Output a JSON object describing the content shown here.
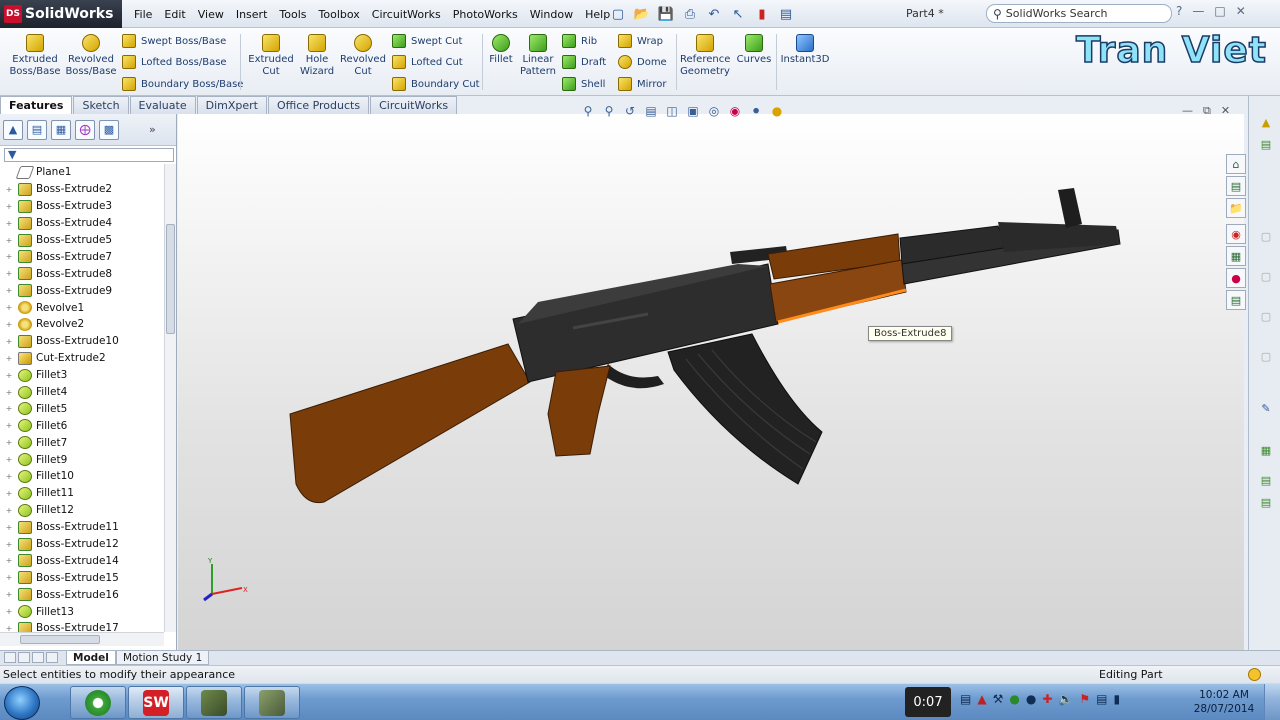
{
  "app": {
    "name": "SolidWorks",
    "doc_title": "Part4 *",
    "brand_text": "Tran Viet"
  },
  "menu": [
    "File",
    "Edit",
    "View",
    "Insert",
    "Tools",
    "Toolbox",
    "CircuitWorks",
    "PhotoWorks",
    "Window",
    "Help"
  ],
  "search": {
    "placeholder": "SolidWorks Search"
  },
  "commands": {
    "extruded_boss": "Extruded Boss/Base",
    "revolved_boss": "Revolved Boss/Base",
    "swept_boss": "Swept Boss/Base",
    "lofted_boss": "Lofted Boss/Base",
    "boundary_boss": "Boundary Boss/Base",
    "extruded_cut": "Extruded Cut",
    "hole_wizard": "Hole Wizard",
    "revolved_cut": "Revolved Cut",
    "swept_cut": "Swept Cut",
    "lofted_cut": "Lofted Cut",
    "boundary_cut": "Boundary Cut",
    "fillet": "Fillet",
    "linear_pattern": "Linear Pattern",
    "rib": "Rib",
    "draft": "Draft",
    "shell": "Shell",
    "wrap": "Wrap",
    "dome": "Dome",
    "mirror": "Mirror",
    "reference_geometry": "Reference Geometry",
    "curves": "Curves",
    "instant3d": "Instant3D"
  },
  "tabs": [
    "Features",
    "Sketch",
    "Evaluate",
    "DimXpert",
    "Office Products",
    "CircuitWorks"
  ],
  "tree": [
    {
      "label": "Plane1",
      "icon": "plane-icon"
    },
    {
      "label": "Boss-Extrude2",
      "icon": "extrude-icon"
    },
    {
      "label": "Boss-Extrude3",
      "icon": "extrude-icon"
    },
    {
      "label": "Boss-Extrude4",
      "icon": "extrude-icon"
    },
    {
      "label": "Boss-Extrude5",
      "icon": "extrude-icon"
    },
    {
      "label": "Boss-Extrude7",
      "icon": "extrude-icon"
    },
    {
      "label": "Boss-Extrude8",
      "icon": "extrude-icon"
    },
    {
      "label": "Boss-Extrude9",
      "icon": "extrude-icon"
    },
    {
      "label": "Revolve1",
      "icon": "revolve-icon"
    },
    {
      "label": "Revolve2",
      "icon": "revolve-icon"
    },
    {
      "label": "Boss-Extrude10",
      "icon": "extrude-icon"
    },
    {
      "label": "Cut-Extrude2",
      "icon": "cut-icon"
    },
    {
      "label": "Fillet3",
      "icon": "fillet-icon"
    },
    {
      "label": "Fillet4",
      "icon": "fillet-icon"
    },
    {
      "label": "Fillet5",
      "icon": "fillet-icon"
    },
    {
      "label": "Fillet6",
      "icon": "fillet-icon"
    },
    {
      "label": "Fillet7",
      "icon": "fillet-icon"
    },
    {
      "label": "Fillet9",
      "icon": "fillet-icon"
    },
    {
      "label": "Fillet10",
      "icon": "fillet-icon"
    },
    {
      "label": "Fillet11",
      "icon": "fillet-icon"
    },
    {
      "label": "Fillet12",
      "icon": "fillet-icon"
    },
    {
      "label": "Boss-Extrude11",
      "icon": "extrude-icon"
    },
    {
      "label": "Boss-Extrude12",
      "icon": "extrude-icon"
    },
    {
      "label": "Boss-Extrude14",
      "icon": "extrude-icon"
    },
    {
      "label": "Boss-Extrude15",
      "icon": "extrude-icon"
    },
    {
      "label": "Boss-Extrude16",
      "icon": "extrude-icon"
    },
    {
      "label": "Fillet13",
      "icon": "fillet-icon"
    },
    {
      "label": "Boss-Extrude17",
      "icon": "extrude-icon"
    }
  ],
  "viewport": {
    "tooltip": "Boss-Extrude8",
    "triad_x": "X",
    "triad_y": "Y"
  },
  "bottom_tabs": [
    "Model",
    "Motion Study 1"
  ],
  "status": {
    "message": "Select entities to modify their appearance",
    "mode": "Editing Part"
  },
  "taskbar": {
    "recording_time": "0:07",
    "clock_time": "10:02 AM",
    "clock_date": "28/07/2014"
  },
  "colors": {
    "wood": "#7a3d0a",
    "metal": "#2b2b2b",
    "highlight": "#ff8c1a",
    "accent": "#2c5a98"
  }
}
